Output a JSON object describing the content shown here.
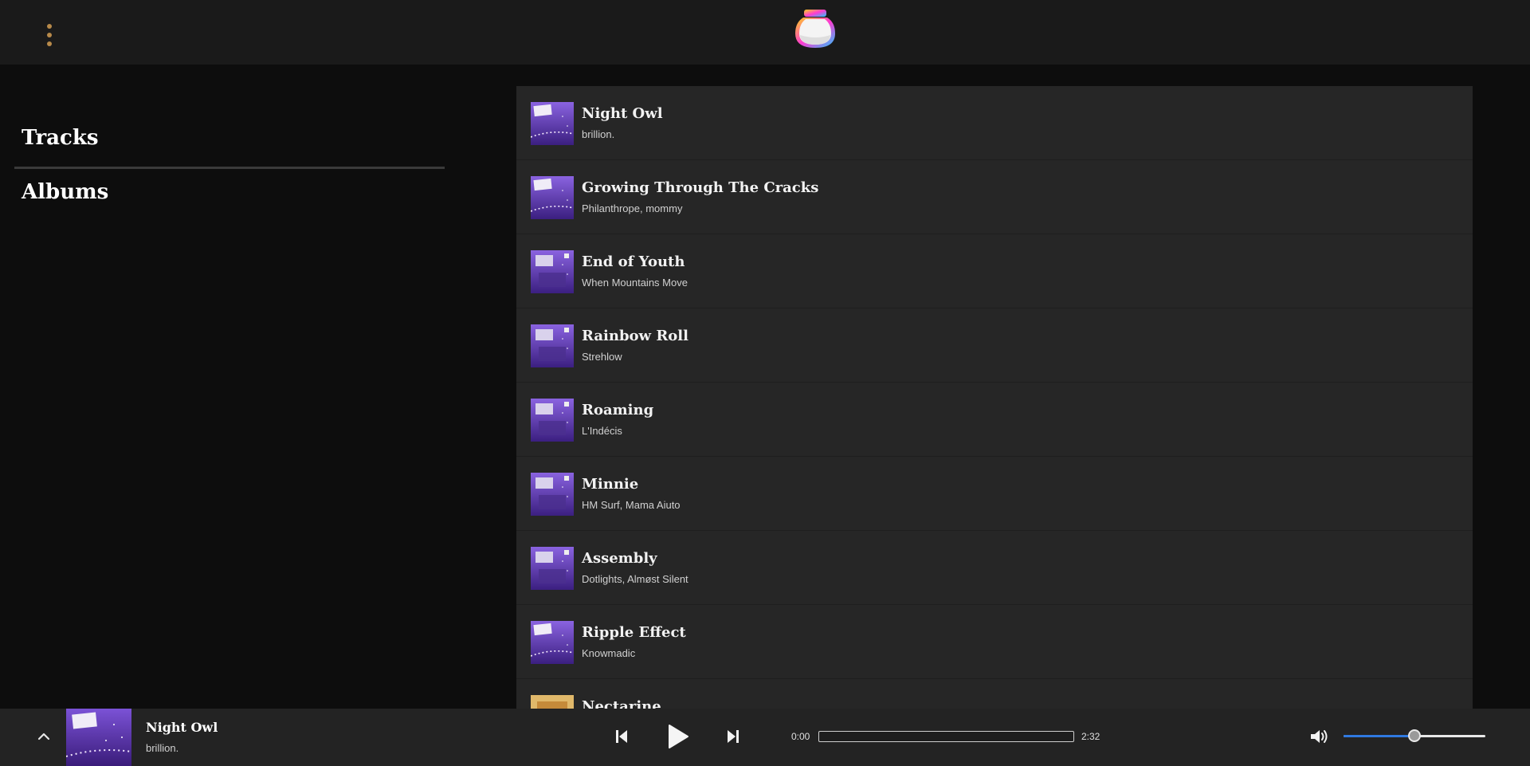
{
  "header": {
    "menu_icon": "more-vertical-icon",
    "logo_icon": "jar-logo-icon"
  },
  "sidebar": {
    "items": [
      {
        "label": "Tracks"
      },
      {
        "label": "Albums"
      }
    ]
  },
  "tracks": [
    {
      "title": "Night Owl",
      "artist": "brillion.",
      "art": "purple-night"
    },
    {
      "title": "Growing Through The Cracks",
      "artist": "Philanthrope, mommy",
      "art": "purple-night"
    },
    {
      "title": "End of Youth",
      "artist": "When Mountains Move",
      "art": "purple-room"
    },
    {
      "title": "Rainbow Roll",
      "artist": "Strehlow",
      "art": "purple-room"
    },
    {
      "title": "Roaming",
      "artist": "L'Indécis",
      "art": "purple-room"
    },
    {
      "title": "Minnie",
      "artist": "HM Surf, Mama Aiuto",
      "art": "purple-room"
    },
    {
      "title": "Assembly",
      "artist": "Dotlights, Almøst Silent",
      "art": "purple-room"
    },
    {
      "title": "Ripple Effect",
      "artist": "Knowmadic",
      "art": "purple-night"
    },
    {
      "title": "Nectarine",
      "artist": "",
      "art": "orange"
    }
  ],
  "player": {
    "title": "Night Owl",
    "artist": "brillion.",
    "current_time": "0:00",
    "duration": "2:32",
    "progress_fraction": 0,
    "volume_fraction": 0.5,
    "accent_color": "#2f79e0"
  },
  "colors": {
    "menu_dots": "#b88a4a",
    "panel_bg": "#262626",
    "header_bg": "#1a1a1a"
  }
}
